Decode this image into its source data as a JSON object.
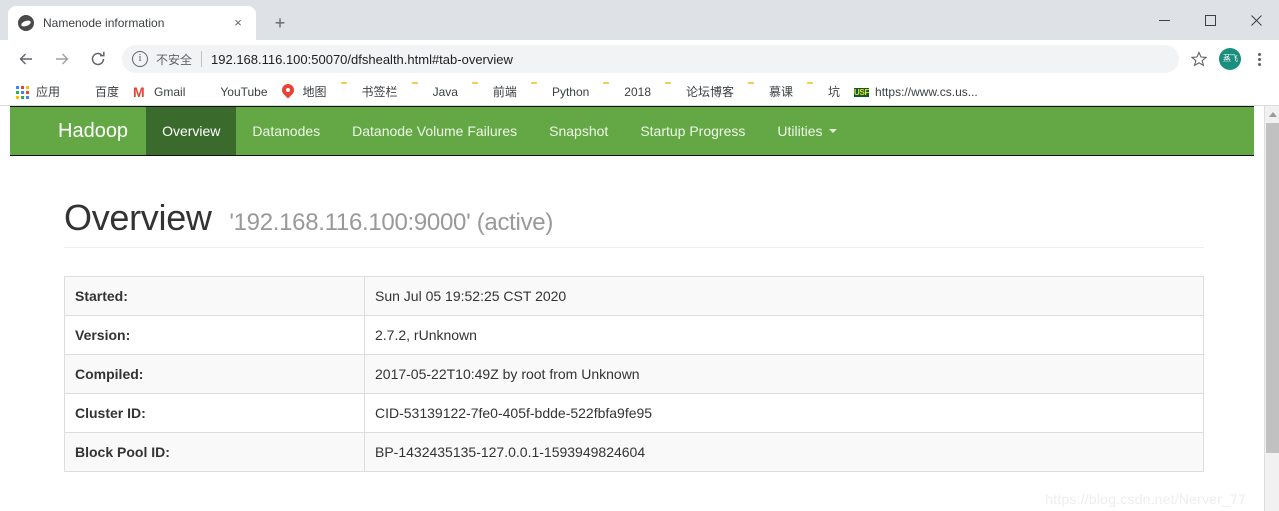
{
  "browser": {
    "tab": {
      "title": "Namenode information",
      "favicon": "hadoop-globe-icon",
      "close": "×"
    },
    "new_tab": "+",
    "window_controls": {
      "minimize": "minimize-icon",
      "maximize": "maximize-icon",
      "close": "close-icon"
    },
    "toolbar": {
      "back": "←",
      "forward": "→",
      "reload": "↻",
      "security_label": "不安全",
      "url": "192.168.116.100:50070/dfshealth.html#tab-overview",
      "bookmark_star": "star-icon",
      "avatar_text": "蒸飞",
      "menu": "kebab-menu-icon"
    },
    "bookmarks": [
      {
        "label": "应用",
        "icon": "apps-grid-icon"
      },
      {
        "label": "百度",
        "icon": "baidu-icon"
      },
      {
        "label": "Gmail",
        "icon": "gmail-icon"
      },
      {
        "label": "YouTube",
        "icon": "youtube-icon"
      },
      {
        "label": "地图",
        "icon": "maps-pin-icon"
      },
      {
        "label": "书签栏",
        "icon": "folder-icon"
      },
      {
        "label": "Java",
        "icon": "folder-icon"
      },
      {
        "label": "前端",
        "icon": "folder-icon"
      },
      {
        "label": "Python",
        "icon": "folder-icon"
      },
      {
        "label": "2018",
        "icon": "folder-icon"
      },
      {
        "label": "论坛博客",
        "icon": "folder-icon"
      },
      {
        "label": "慕课",
        "icon": "folder-icon"
      },
      {
        "label": "坑",
        "icon": "folder-icon"
      },
      {
        "label": "https://www.cs.us...",
        "icon": "usf-icon"
      }
    ]
  },
  "page": {
    "brand": "Hadoop",
    "nav": [
      {
        "label": "Overview",
        "active": true,
        "caret": false
      },
      {
        "label": "Datanodes",
        "active": false,
        "caret": false
      },
      {
        "label": "Datanode Volume Failures",
        "active": false,
        "caret": false
      },
      {
        "label": "Snapshot",
        "active": false,
        "caret": false
      },
      {
        "label": "Startup Progress",
        "active": false,
        "caret": false
      },
      {
        "label": "Utilities",
        "active": false,
        "caret": true
      }
    ],
    "heading": {
      "title": "Overview",
      "subtitle": "'192.168.116.100:9000' (active)"
    },
    "table": [
      {
        "key": "Started:",
        "value": "Sun Jul 05 19:52:25 CST 2020"
      },
      {
        "key": "Version:",
        "value": "2.7.2, rUnknown"
      },
      {
        "key": "Compiled:",
        "value": "2017-05-22T10:49Z by root from Unknown"
      },
      {
        "key": "Cluster ID:",
        "value": "CID-53139122-7fe0-405f-bdde-522fbfa9fe95"
      },
      {
        "key": "Block Pool ID:",
        "value": "BP-1432435135-127.0.0.1-1593949824604"
      }
    ],
    "watermark": "https://blog.csdn.net/Nerver_77"
  },
  "colors": {
    "navbar_green": "#63a844",
    "active_tab_green": "#3b6b2c",
    "avatar_teal": "#1a8f7e"
  }
}
